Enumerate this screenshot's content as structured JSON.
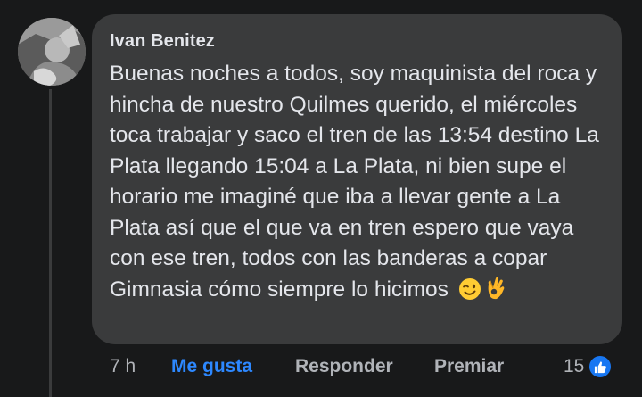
{
  "comment": {
    "author": "Ivan Benitez",
    "text": "Buenas noches a todos, soy maquinista del roca y hincha de nuestro Quilmes querido, el miércoles toca trabajar y saco el tren de las 13:54 destino La Plata llegando 15:04 a La Plata, ni bien supe el horario me imaginé que iba a llevar gente a La Plata así que el que va en tren espero que vaya con ese tren, todos con las banderas a copar Gimnasia cómo siempre lo hicimos",
    "emojis": [
      "winking-face-icon",
      "ok-hand-icon"
    ]
  },
  "actions": {
    "time": "7 h",
    "like_label": "Me gusta",
    "reply_label": "Responder",
    "award_label": "Premiar",
    "reaction_count": "15",
    "reaction_icon": "thumbs-up-icon"
  },
  "colors": {
    "background": "#18191a",
    "bubble": "#3a3b3c",
    "text": "#e4e6eb",
    "secondary_text": "#b0b3b8",
    "link_blue": "#2d88ff",
    "like_badge": "#1877f2"
  }
}
